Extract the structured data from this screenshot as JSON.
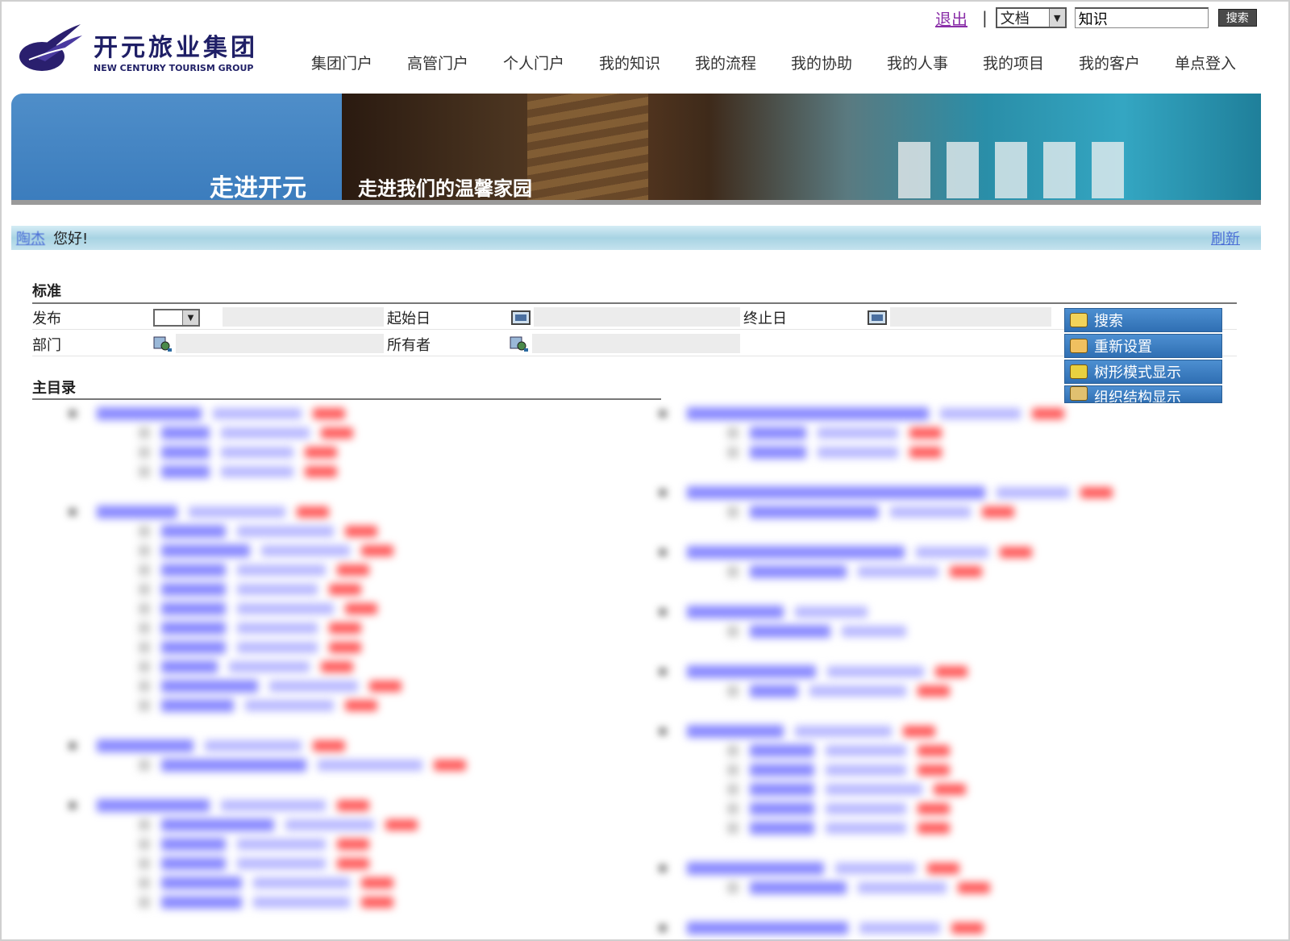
{
  "header": {
    "logout_label": "退出",
    "separator": "|",
    "search_type": "文档",
    "search_value": "知识",
    "search_button": "搜索"
  },
  "logo": {
    "cn_name": "开元旅业集团",
    "en_name": "NEW CENTURY TOURISM GROUP"
  },
  "nav": {
    "items": [
      "集团门户",
      "高管门户",
      "个人门户",
      "我的知识",
      "我的流程",
      "我的协助",
      "我的人事",
      "我的项目",
      "我的客户",
      "单点登入"
    ]
  },
  "banner": {
    "title": "走进开元",
    "subtitle": "走进我们的温馨家园",
    "brand_color": "#3b7cbd"
  },
  "welcome": {
    "user": "陶杰",
    "greeting": "您好!",
    "refresh_label": "刷新"
  },
  "filter": {
    "section_title": "标准",
    "publish_label": "发布",
    "start_label": "起始日",
    "end_label": "终止日",
    "dept_label": "部门",
    "owner_label": "所有者"
  },
  "actions": {
    "items": [
      {
        "label": "搜索",
        "icon": "search-icon"
      },
      {
        "label": "重新设置",
        "icon": "reset-icon"
      },
      {
        "label": "树形模式显示",
        "icon": "tree-icon"
      },
      {
        "label": "组织结构显示",
        "icon": "org-icon"
      }
    ]
  },
  "directory": {
    "title": "主目录"
  }
}
